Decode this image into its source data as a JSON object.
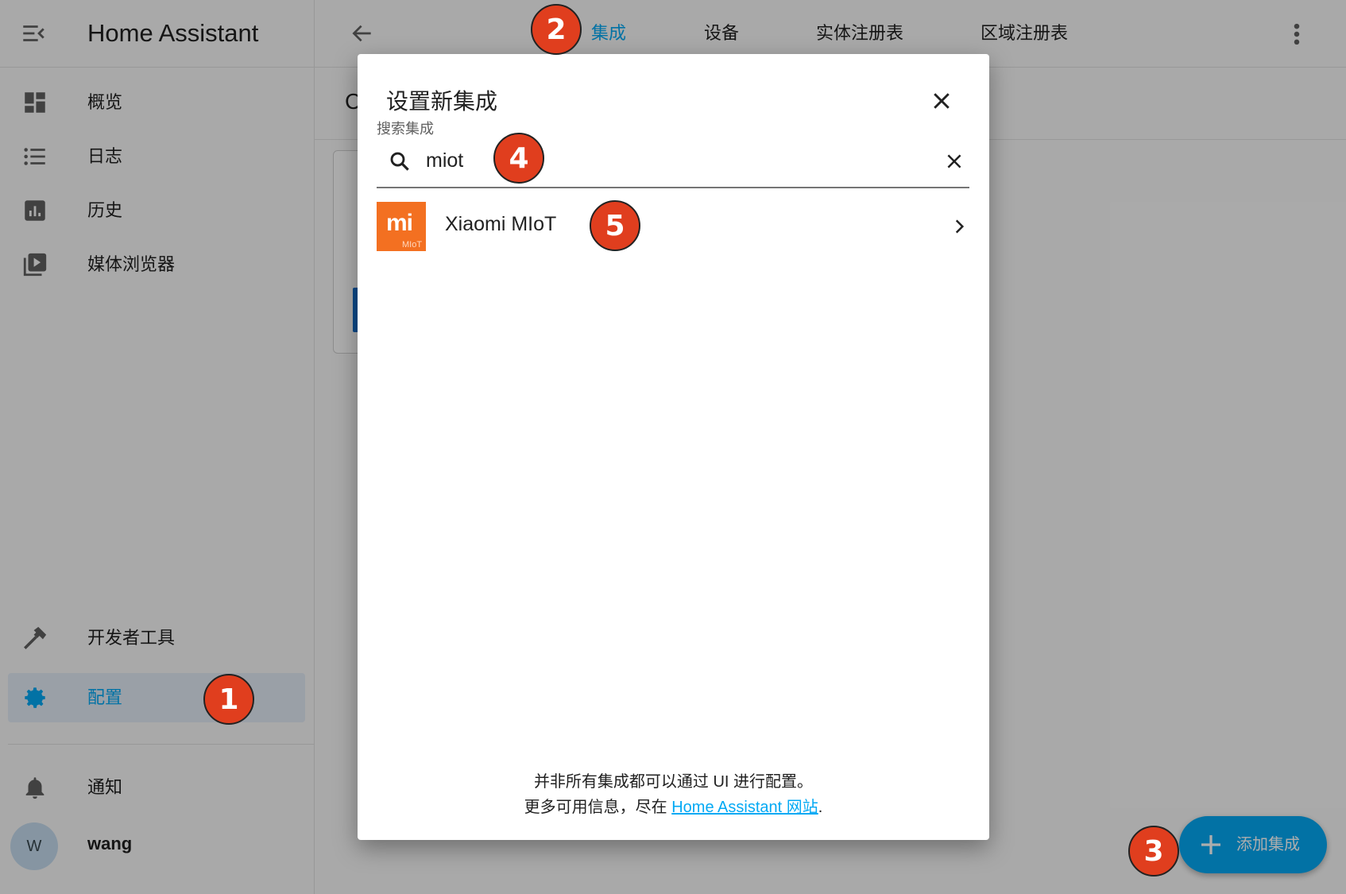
{
  "app": {
    "title": "Home Assistant"
  },
  "sidebar": {
    "items": [
      {
        "label": "概览",
        "icon": "dashboard-icon"
      },
      {
        "label": "日志",
        "icon": "logbook-icon"
      },
      {
        "label": "历史",
        "icon": "history-chart-icon"
      },
      {
        "label": "媒体浏览器",
        "icon": "media-browser-icon"
      },
      {
        "label": "开发者工具",
        "icon": "hammer-icon"
      },
      {
        "label": "配置",
        "icon": "gear-icon",
        "active": true
      },
      {
        "label": "通知",
        "icon": "bell-icon"
      }
    ],
    "user": {
      "initial": "W",
      "name": "wang"
    }
  },
  "topbar": {
    "tabs": [
      {
        "label": "集成",
        "active": true
      },
      {
        "label": "设备"
      },
      {
        "label": "实体注册表"
      },
      {
        "label": "区域注册表"
      }
    ]
  },
  "subbar": {
    "text": "C"
  },
  "fab": {
    "label": "添加集成"
  },
  "dialog": {
    "title": "设置新集成",
    "search": {
      "label": "搜索集成",
      "value": "miot"
    },
    "results": [
      {
        "name": "Xiaomi MIoT",
        "logo_text": "mi",
        "logo_sub": "MIoT"
      }
    ],
    "footer": {
      "line1": "并非所有集成都可以通过 UI 进行配置。",
      "line2_prefix": "更多可用信息，尽在 ",
      "link": "Home Assistant 网站",
      "line2_suffix": "."
    }
  },
  "badges": [
    "1",
    "2",
    "3",
    "4",
    "5"
  ],
  "colors": {
    "accent": "#03a9f4",
    "badge": "#e03e1e",
    "mi_brand": "#f37021"
  }
}
